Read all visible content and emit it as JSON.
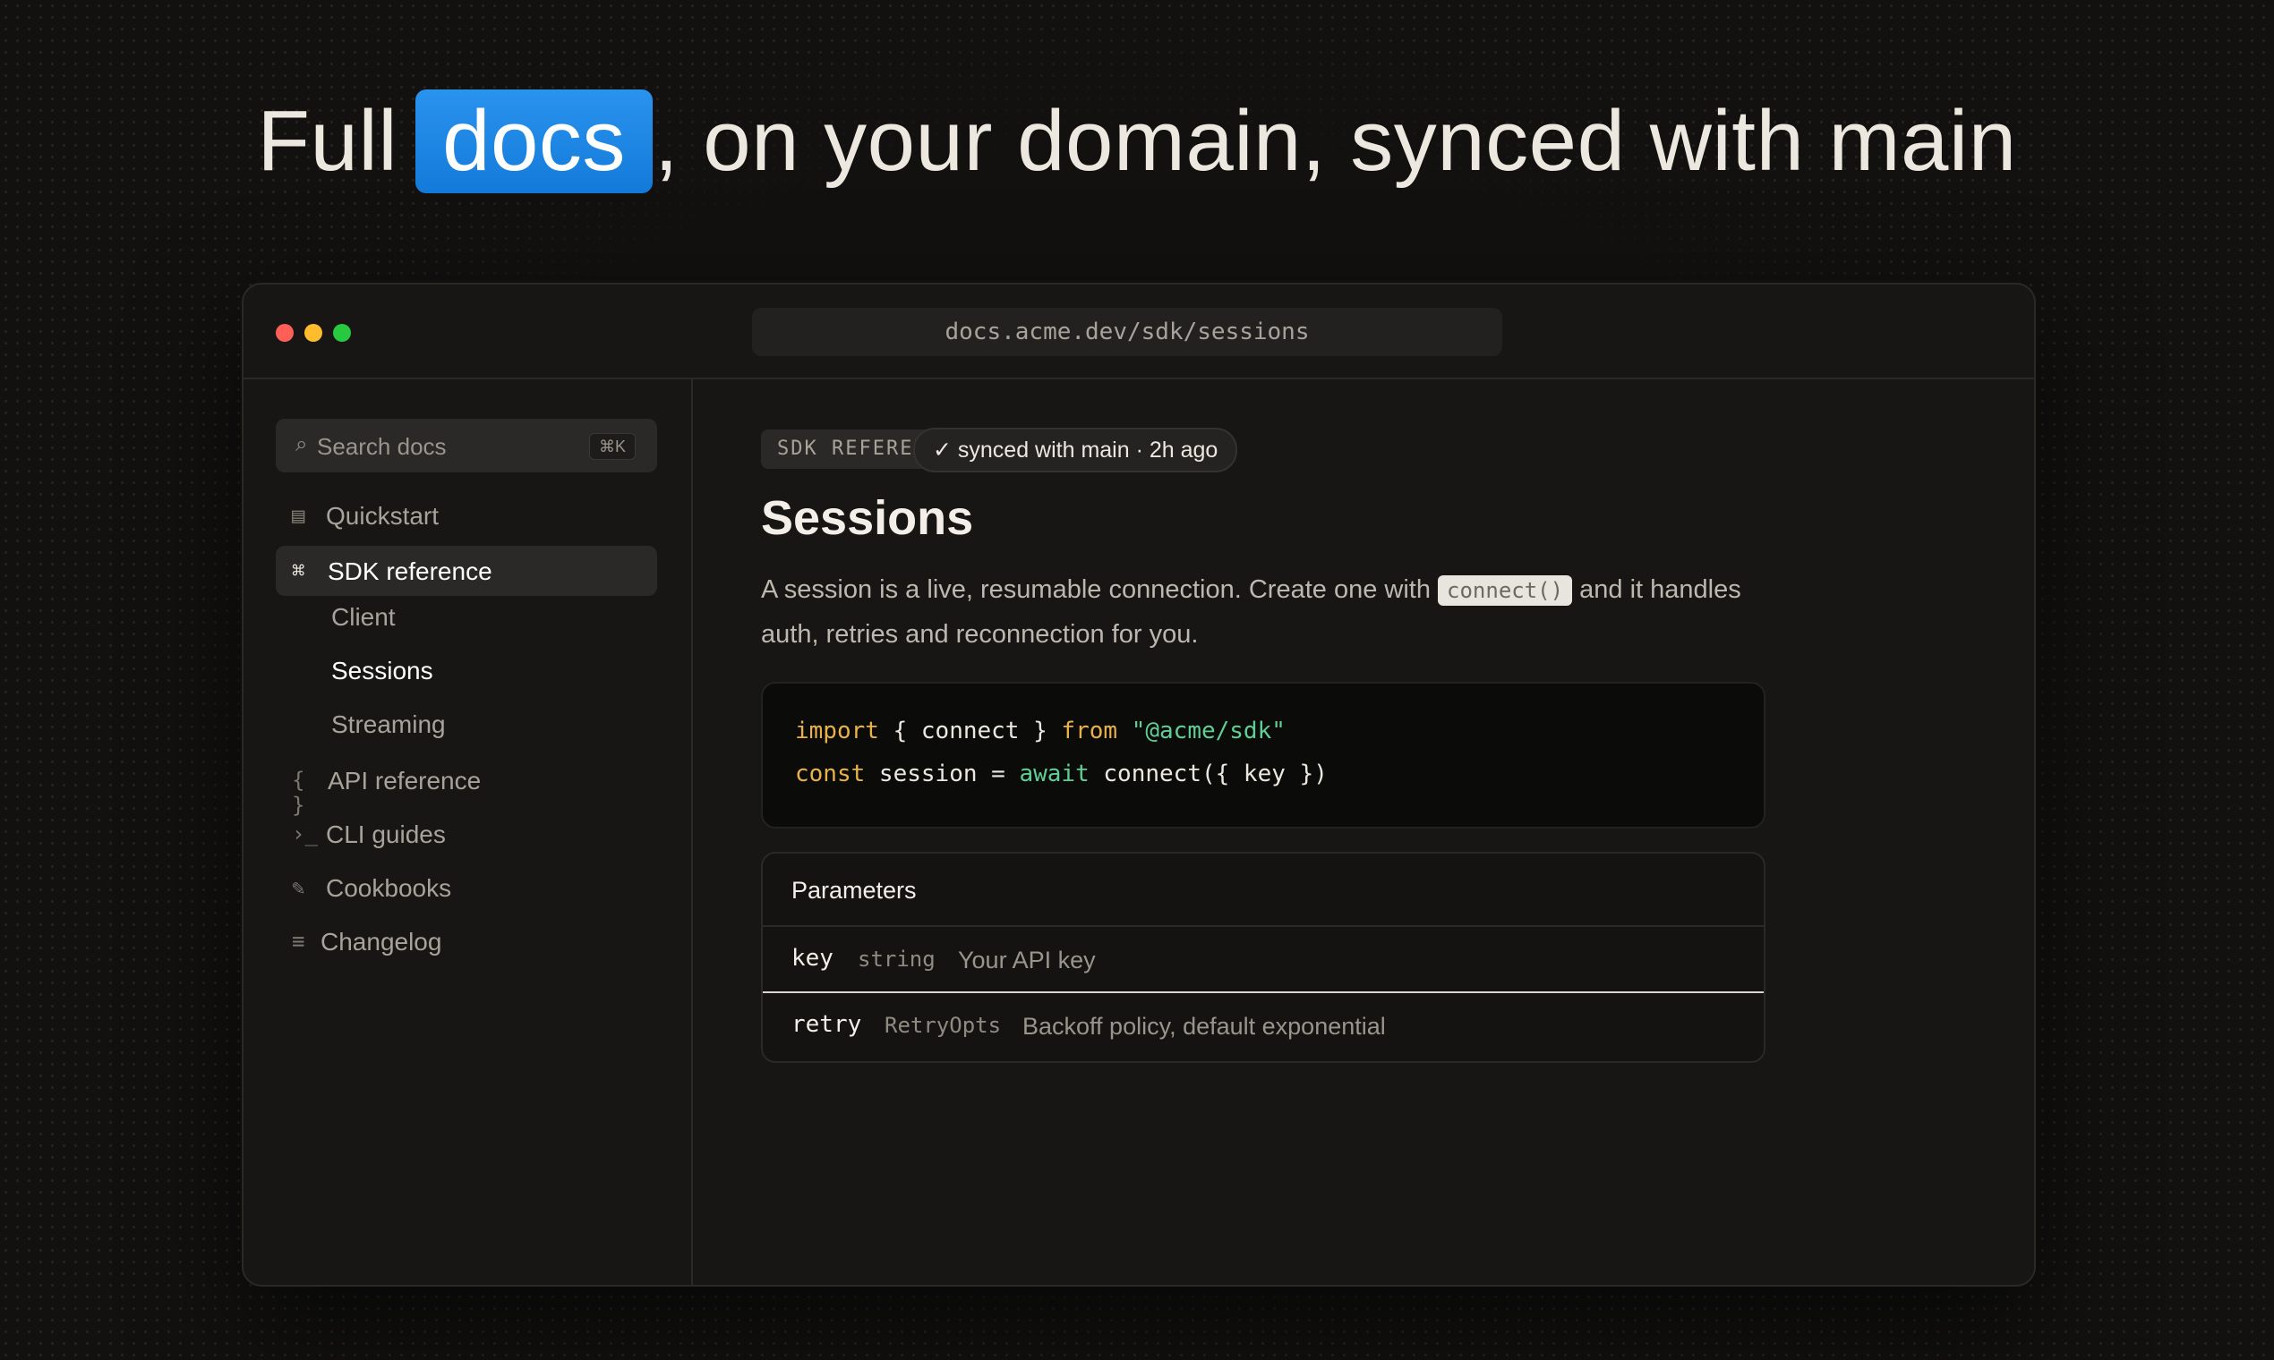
{
  "headline": {
    "before": "Full",
    "highlight": "docs",
    "after": ", on your domain, synced with main"
  },
  "window": {
    "url": "docs.acme.dev/sdk/sessions",
    "traffic_lights": [
      "#ff5f57",
      "#febc2e",
      "#28c840"
    ]
  },
  "sidebar": {
    "search": {
      "icon": "search-icon",
      "label": "Search docs",
      "shortcut": "⌘K"
    },
    "items": [
      {
        "icon": "book-icon",
        "icon_glyph": "▤",
        "label": "Quickstart"
      },
      {
        "icon": "command-icon",
        "icon_glyph": "⌘",
        "label": "SDK reference",
        "active": true,
        "children": [
          {
            "label": "Client"
          },
          {
            "label": "Sessions",
            "current": true
          },
          {
            "label": "Streaming"
          }
        ]
      },
      {
        "icon": "braces-icon",
        "icon_glyph": "{ }",
        "label": "API reference"
      },
      {
        "icon": "terminal-icon",
        "icon_glyph": "›_",
        "label": "CLI guides"
      },
      {
        "icon": "pencil-icon",
        "icon_glyph": "✎",
        "label": "Cookbooks"
      },
      {
        "icon": "list-icon",
        "icon_glyph": "≡",
        "label": "Changelog"
      }
    ]
  },
  "main": {
    "badge": "SDK REFERENCE",
    "sync_status": "✓ synced with main · 2h ago",
    "title": "Sessions",
    "description": {
      "before": "A session is a live, resumable connection. Create one with",
      "code": "connect()",
      "after": "and it handles auth, retries and reconnection for you."
    },
    "code": {
      "line1": {
        "kw1": "import",
        "mid": " { connect } ",
        "kw2": "from",
        "str": " \"@acme/sdk\""
      },
      "line2": {
        "kw1": "const",
        "mid": " session = ",
        "kw2": "await",
        "rest": " connect({ key })"
      }
    },
    "parameters": {
      "heading": "Parameters",
      "rows": [
        {
          "name": "key",
          "type": "string",
          "description": "Your API key"
        },
        {
          "name": "retry",
          "type": "RetryOpts",
          "description": "Backoff policy, default exponential"
        }
      ]
    }
  },
  "colors": {
    "accent": "#1a86e3",
    "keyword": "#e8b14a",
    "string": "#5fcf95",
    "background": "#121110"
  }
}
